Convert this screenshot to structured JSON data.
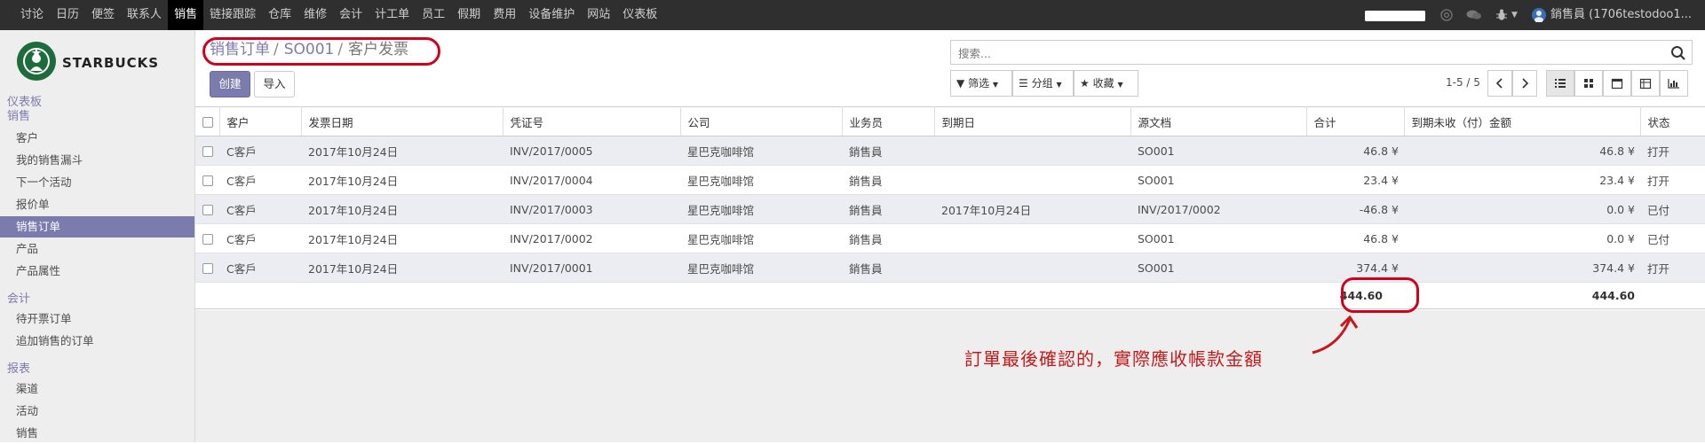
{
  "topbar": {
    "menu": [
      "讨论",
      "日历",
      "便签",
      "联系人",
      "销售",
      "链接跟踪",
      "仓库",
      "维修",
      "会计",
      "计工单",
      "员工",
      "假期",
      "费用",
      "设备维护",
      "网站",
      "仪表板"
    ],
    "active_index": 4,
    "user_label": "銷售員 (1706testodoo1...",
    "progress": 1.0,
    "icons": [
      "at-icon",
      "chat-icon",
      "bug-icon",
      "user-avatar-icon"
    ]
  },
  "sidebar": {
    "logo_text": "STARBUCKS",
    "dashboard": "仪表板",
    "sections": [
      {
        "title": "销售",
        "items": [
          "客户",
          "我的销售漏斗",
          "下一个活动",
          "报价单",
          "销售订单",
          "产品",
          "产品属性"
        ]
      },
      {
        "title": "会计",
        "items": [
          "待开票订单",
          "追加销售的订单"
        ]
      },
      {
        "title": "报表",
        "items": [
          "渠道",
          "活动",
          "销售"
        ]
      }
    ],
    "active_item": "销售订单"
  },
  "breadcrumb": {
    "parts": [
      "销售订单",
      "SO001",
      "客户发票"
    ],
    "separator": "/"
  },
  "buttons": {
    "create": "创建",
    "import": "导入"
  },
  "search": {
    "placeholder": "搜索..."
  },
  "filters": {
    "filter": "筛选",
    "group": "分组",
    "favorite": "收藏"
  },
  "pager": {
    "text": "1-5 / 5"
  },
  "table": {
    "headers": [
      "客户",
      "发票日期",
      "凭证号",
      "公司",
      "业务员",
      "到期日",
      "源文档",
      "合计",
      "到期未收（付）金额",
      "状态"
    ],
    "rows": [
      [
        "C客戶",
        "2017年10月24日",
        "INV/2017/0005",
        "星巴克咖啡馆",
        "銷售員",
        "",
        "SO001",
        "46.8 ¥",
        "46.8 ¥",
        "打开"
      ],
      [
        "C客戶",
        "2017年10月24日",
        "INV/2017/0004",
        "星巴克咖啡馆",
        "銷售員",
        "",
        "SO001",
        "23.4 ¥",
        "23.4 ¥",
        "打开"
      ],
      [
        "C客戶",
        "2017年10月24日",
        "INV/2017/0003",
        "星巴克咖啡馆",
        "銷售員",
        "2017年10月24日",
        "INV/2017/0002",
        "-46.8 ¥",
        "0.0 ¥",
        "已付"
      ],
      [
        "C客戶",
        "2017年10月24日",
        "INV/2017/0002",
        "星巴克咖啡馆",
        "銷售員",
        "",
        "SO001",
        "46.8 ¥",
        "0.0 ¥",
        "已付"
      ],
      [
        "C客戶",
        "2017年10月24日",
        "INV/2017/0001",
        "星巴克咖啡馆",
        "銷售員",
        "",
        "SO001",
        "374.4 ¥",
        "374.4 ¥",
        "打开"
      ]
    ],
    "totals": {
      "total": "444.60",
      "residual": "444.60"
    }
  },
  "annotation": {
    "text": "訂單最後確認的，實際應收帳款金額",
    "color": "#c41a1a"
  },
  "colors": {
    "accent": "#7c7bad",
    "highlight_red": "#d0021b",
    "topbar": "#2f2f2f"
  }
}
